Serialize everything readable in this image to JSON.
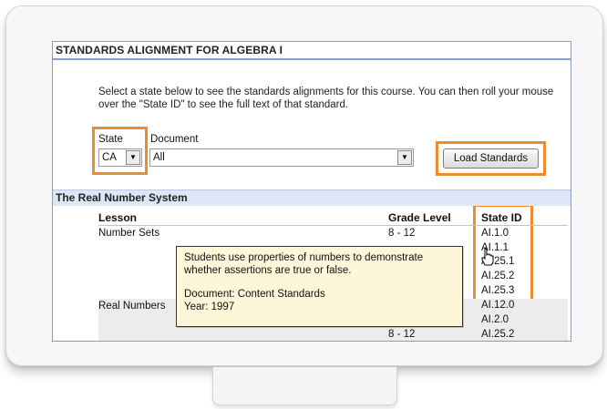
{
  "header": {
    "title": "STANDARDS ALIGNMENT FOR ALGEBRA I"
  },
  "intro": {
    "text": "Select a state below to see the standards alignments for this course. You can then roll your mouse over the \"State ID\" to see the full text of that standard."
  },
  "controls": {
    "state_label": "State",
    "state_value": "CA",
    "document_label": "Document",
    "document_value": "All",
    "load_button": "Load Standards",
    "dropdown_icon": "triangle-down"
  },
  "section": {
    "title": "The Real Number System"
  },
  "table": {
    "headers": {
      "lesson": "Lesson",
      "grade": "Grade Level",
      "state_id": "State ID"
    },
    "rows": [
      {
        "lesson": "Number Sets",
        "grade": "8 - 12"
      },
      {
        "lesson": "Real Numbers",
        "grade": ""
      },
      {
        "lesson": "",
        "grade": "8 - 12"
      }
    ],
    "state_ids": [
      "AI.1.0",
      "AI.1.1",
      "AI.25.1",
      "AI.25.2",
      "AI.25.3",
      "AI.12.0",
      "AI.2.0",
      "AI.25.2"
    ]
  },
  "tooltip": {
    "line1": "Students use properties of numbers to demonstrate",
    "line2": "whether assertions are true or false.",
    "document": "Document: Content Standards",
    "year": "Year: 1997"
  },
  "colors": {
    "highlight": "#f08a2c",
    "section_bg": "#dde6f5",
    "tooltip_bg": "#fdf6d8"
  }
}
